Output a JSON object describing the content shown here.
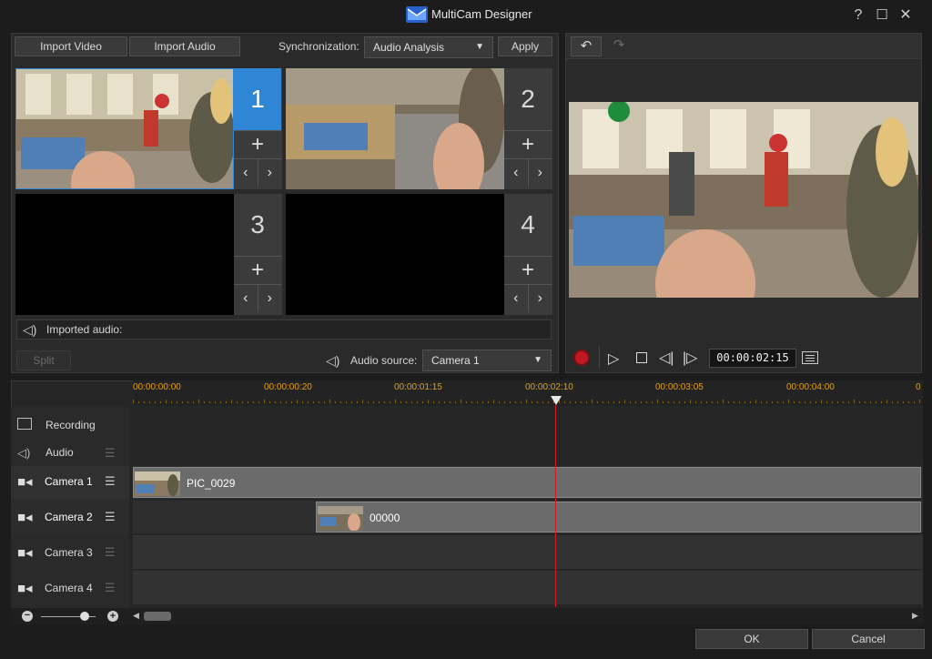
{
  "window": {
    "title": "MultiCam Designer",
    "help": "?",
    "maximize": "☐",
    "close": "✕"
  },
  "toolbar": {
    "import_video": "Import Video",
    "import_audio": "Import Audio",
    "sync_label": "Synchronization:",
    "sync_value": "Audio Analysis",
    "apply": "Apply"
  },
  "cameras": [
    {
      "num": "1",
      "selected": true
    },
    {
      "num": "2",
      "selected": false
    },
    {
      "num": "3",
      "selected": false
    },
    {
      "num": "4",
      "selected": false
    }
  ],
  "imported_audio": "Imported audio:",
  "split": "Split",
  "audio_source": {
    "label": "Audio source:",
    "value": "Camera 1"
  },
  "preview": {
    "timecode": "00:00:02:15"
  },
  "timeline": {
    "ticks": [
      "00:00:00:00",
      "00:00:00:20",
      "00:00:01:15",
      "00:00:02:10",
      "00:00:03:05",
      "00:00:04:00",
      "0"
    ],
    "tracks": {
      "recording": "Recording",
      "audio": "Audio",
      "camera1": "Camera 1",
      "camera2": "Camera 2",
      "camera3": "Camera 3",
      "camera4": "Camera 4"
    },
    "clips": {
      "camera1": "PIC_0029",
      "camera2": "00000"
    }
  },
  "footer": {
    "ok": "OK",
    "cancel": "Cancel"
  },
  "colors": {
    "accent": "#2e86d4",
    "playhead": "#d22020",
    "ruler": "#e1a11a",
    "record": "#c0181f"
  }
}
